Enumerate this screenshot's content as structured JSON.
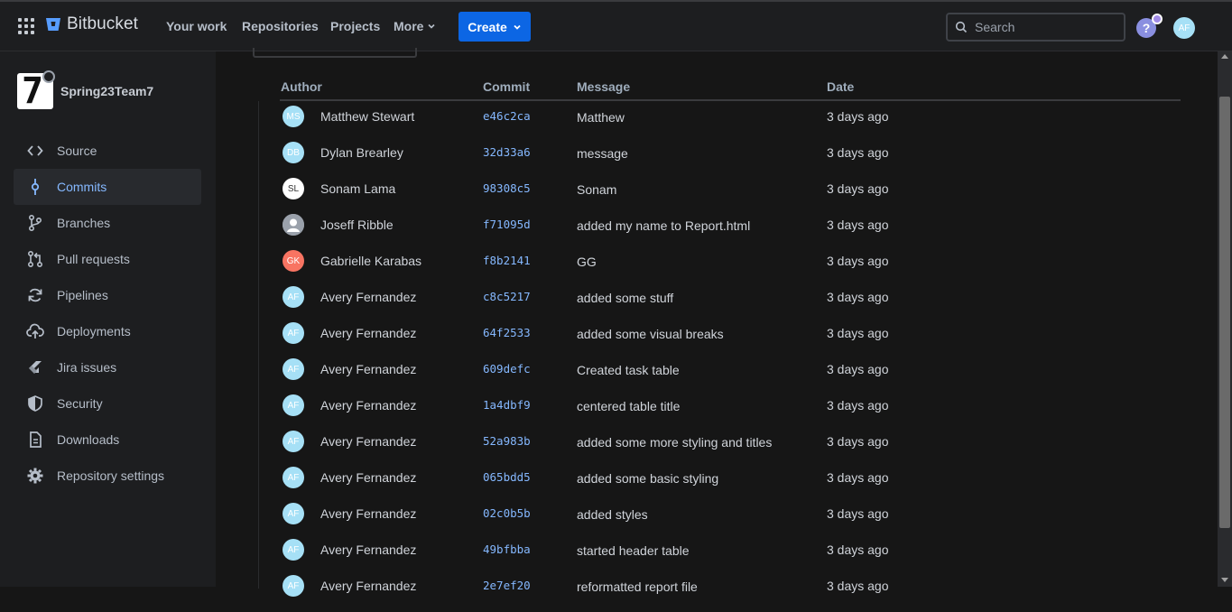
{
  "header": {
    "brand": "Bitbucket",
    "nav": [
      "Your work",
      "Repositories",
      "Projects",
      "More"
    ],
    "create_label": "Create",
    "search_placeholder": "Search",
    "help_glyph": "?",
    "user_initials": "AF"
  },
  "sidebar": {
    "repo_name": "Spring23Team7",
    "items": [
      {
        "label": "Source",
        "icon": "code-icon"
      },
      {
        "label": "Commits",
        "icon": "commit-icon",
        "active": true
      },
      {
        "label": "Branches",
        "icon": "branch-icon"
      },
      {
        "label": "Pull requests",
        "icon": "pull-request-icon"
      },
      {
        "label": "Pipelines",
        "icon": "pipelines-icon"
      },
      {
        "label": "Deployments",
        "icon": "cloud-upload-icon"
      },
      {
        "label": "Jira issues",
        "icon": "jira-icon"
      },
      {
        "label": "Security",
        "icon": "shield-icon"
      },
      {
        "label": "Downloads",
        "icon": "document-icon"
      },
      {
        "label": "Repository settings",
        "icon": "gear-icon"
      }
    ]
  },
  "commits": {
    "columns": [
      "Author",
      "Commit",
      "Message",
      "Date"
    ],
    "rows": [
      {
        "initials": "MS",
        "avatar_color": "#a6e0f6",
        "author": "Matthew Stewart",
        "hash": "e46c2ca",
        "message": "Matthew",
        "date": "3 days ago"
      },
      {
        "initials": "DB",
        "avatar_color": "#a6e0f6",
        "author": "Dylan Brearley",
        "hash": "32d33a6",
        "message": "message",
        "date": "3 days ago"
      },
      {
        "initials": "SL",
        "avatar_color": "#ffffff",
        "author": "Sonam Lama",
        "hash": "98308c5",
        "message": "Sonam",
        "date": "3 days ago"
      },
      {
        "initials": "",
        "avatar_color": "#9aa1ab",
        "author": "Joseff Ribble",
        "hash": "f71095d",
        "message": "added my name to Report.html",
        "date": "3 days ago"
      },
      {
        "initials": "GK",
        "avatar_color": "#f87462",
        "author": "Gabrielle Karabas",
        "hash": "f8b2141",
        "message": "GG",
        "date": "3 days ago"
      },
      {
        "initials": "AF",
        "avatar_color": "#a6e0f6",
        "author": "Avery Fernandez",
        "hash": "c8c5217",
        "message": "added some stuff",
        "date": "3 days ago"
      },
      {
        "initials": "AF",
        "avatar_color": "#a6e0f6",
        "author": "Avery Fernandez",
        "hash": "64f2533",
        "message": "added some visual breaks",
        "date": "3 days ago"
      },
      {
        "initials": "AF",
        "avatar_color": "#a6e0f6",
        "author": "Avery Fernandez",
        "hash": "609defc",
        "message": "Created task table",
        "date": "3 days ago"
      },
      {
        "initials": "AF",
        "avatar_color": "#a6e0f6",
        "author": "Avery Fernandez",
        "hash": "1a4dbf9",
        "message": "centered table title",
        "date": "3 days ago"
      },
      {
        "initials": "AF",
        "avatar_color": "#a6e0f6",
        "author": "Avery Fernandez",
        "hash": "52a983b",
        "message": "added some more styling and titles",
        "date": "3 days ago"
      },
      {
        "initials": "AF",
        "avatar_color": "#a6e0f6",
        "author": "Avery Fernandez",
        "hash": "065bdd5",
        "message": "added some basic styling",
        "date": "3 days ago"
      },
      {
        "initials": "AF",
        "avatar_color": "#a6e0f6",
        "author": "Avery Fernandez",
        "hash": "02c0b5b",
        "message": "added styles",
        "date": "3 days ago"
      },
      {
        "initials": "AF",
        "avatar_color": "#a6e0f6",
        "author": "Avery Fernandez",
        "hash": "49bfbba",
        "message": "started header table",
        "date": "3 days ago"
      },
      {
        "initials": "AF",
        "avatar_color": "#a6e0f6",
        "author": "Avery Fernandez",
        "hash": "2e7ef20",
        "message": "reformatted report file",
        "date": "3 days ago"
      }
    ]
  },
  "colors": {
    "accent": "#0c66e4",
    "link": "#85b8ff",
    "background": "#161616",
    "sidebar": "#1d1e20"
  }
}
